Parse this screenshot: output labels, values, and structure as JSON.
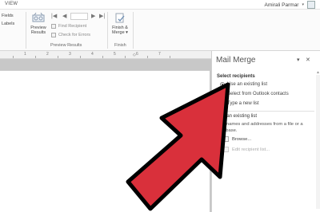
{
  "ribbon": {
    "tab_view": "VIEW",
    "account_name": "Amirali Parmar",
    "groups": {
      "fields_labels": {
        "line1": "Fields",
        "line2": "Labels"
      },
      "preview_results": {
        "preview_button": {
          "line1": "Preview",
          "line2": "Results"
        },
        "find_recipient": "Find Recipient",
        "check_errors": "Check for Errors",
        "label": "Preview Results"
      },
      "finish": {
        "finish_merge": {
          "line1": "Finish &",
          "line2": "Merge ▾"
        },
        "label": "Finish"
      }
    }
  },
  "ruler": {
    "numbers": [
      "1",
      "2",
      "3",
      "4",
      "5",
      "6",
      "7"
    ]
  },
  "pane": {
    "title": "Mail Merge",
    "select_recipients": {
      "heading": "Select recipients",
      "options": [
        {
          "label": "Use an existing list",
          "selected": true
        },
        {
          "label": "Select from Outlook contacts",
          "selected": false
        },
        {
          "label": "Type a new list",
          "selected": false
        }
      ]
    },
    "use_existing": {
      "heading": "Use an existing list",
      "description": "Use names and addresses from a file or a database.",
      "browse": "Browse...",
      "edit_list": "Edit recipient list..."
    }
  },
  "colors": {
    "arrow_fill": "#d9303b",
    "arrow_stroke": "#000000"
  }
}
